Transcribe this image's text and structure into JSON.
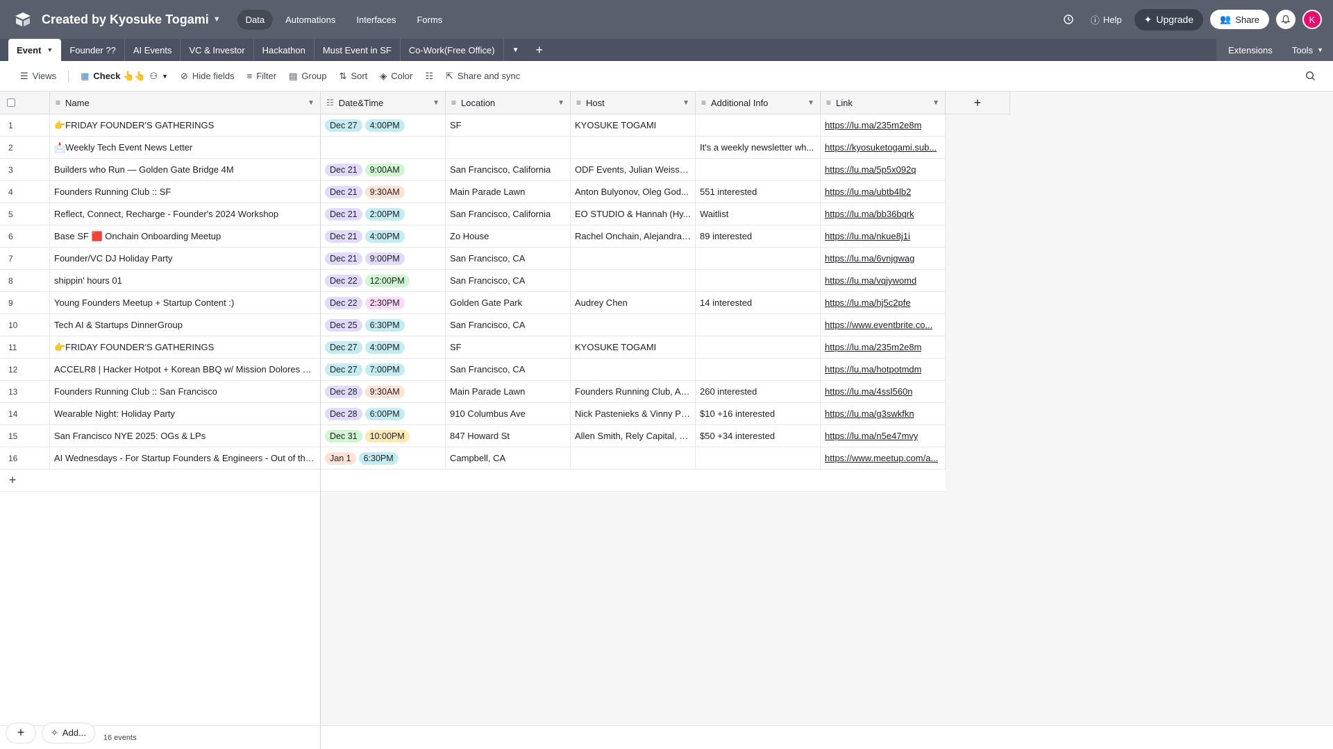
{
  "header": {
    "base_title": "Created by Kyosuke Togami",
    "nav": [
      "Data",
      "Automations",
      "Interfaces",
      "Forms"
    ],
    "help": "Help",
    "upgrade": "Upgrade",
    "share": "Share",
    "avatar_initial": "K"
  },
  "tabs": {
    "items": [
      "Event",
      "Founder ??",
      "AI Events",
      "VC & Investor",
      "Hackathon",
      "Must Event in SF",
      "Co-Work(Free Office)"
    ],
    "extensions": "Extensions",
    "tools": "Tools"
  },
  "toolbar": {
    "views": "Views",
    "view_name": "Check 👆👆",
    "hide_fields": "Hide fields",
    "filter": "Filter",
    "group": "Group",
    "sort": "Sort",
    "color": "Color",
    "share_sync": "Share and sync"
  },
  "columns": {
    "name": "Name",
    "date": "Date&Time",
    "location": "Location",
    "host": "Host",
    "info": "Additional Info",
    "link": "Link"
  },
  "colors": {
    "teal": "#c4ecf0",
    "purple": "#e2d9fb",
    "green": "#cff5d1",
    "orange": "#fee2d5",
    "pink": "#ffdaf6",
    "yellow": "#ffeab6"
  },
  "rows": [
    {
      "num": "1",
      "name": "👉FRIDAY FOUNDER'S GATHERINGS",
      "date": "Dec 27",
      "date_color": "teal",
      "time": "4:00PM",
      "time_color": "teal",
      "location": "SF",
      "host": "KYOSUKE TOGAMI",
      "info": "",
      "link": "https://lu.ma/235m2e8m"
    },
    {
      "num": "2",
      "name": "📩Weekly Tech Event News Letter",
      "date": "",
      "date_color": "",
      "time": "",
      "time_color": "",
      "location": "",
      "host": "",
      "info": "It's a weekly newsletter wh...",
      "link": "https://kyosuketogami.sub..."
    },
    {
      "num": "3",
      "name": "Builders who Run — Golden Gate Bridge 4M",
      "date": "Dec 21",
      "date_color": "purple",
      "time": "9:00AM",
      "time_color": "green",
      "location": "San Francisco, California",
      "host": "ODF Events, Julian Weisser, ...",
      "info": "",
      "link": "https://lu.ma/5p5x092q"
    },
    {
      "num": "4",
      "name": "Founders Running Club :: SF",
      "date": "Dec 21",
      "date_color": "purple",
      "time": "9:30AM",
      "time_color": "orange",
      "location": "Main Parade Lawn",
      "host": "Anton Bulyonov, Oleg God...",
      "info": "551 interested",
      "link": "https://lu.ma/ubtb4lb2"
    },
    {
      "num": "5",
      "name": "Reflect, Connect, Recharge - Founder's 2024 Workshop",
      "date": "Dec 21",
      "date_color": "purple",
      "time": "2:00PM",
      "time_color": "teal",
      "location": "San Francisco, California",
      "host": "EO STUDIO & Hannah (Hy...",
      "info": "Waitlist",
      "link": "https://lu.ma/bb36bqrk"
    },
    {
      "num": "6",
      "name": "Base SF 🟥 Onchain Onboarding Meetup",
      "date": "Dec 21",
      "date_color": "purple",
      "time": "4:00PM",
      "time_color": "teal",
      "location": "Zo House",
      "host": "Rachel Onchain, Alejandra ...",
      "info": "89 interested",
      "link": "https://lu.ma/nkue8j1i"
    },
    {
      "num": "7",
      "name": "Founder/VC DJ Holiday Party",
      "date": "Dec 21",
      "date_color": "purple",
      "time": "9:00PM",
      "time_color": "purple",
      "location": "San Francisco, CA",
      "host": "",
      "info": "",
      "link": "https://lu.ma/6vnjgwag"
    },
    {
      "num": "8",
      "name": "shippin' hours 01",
      "date": "Dec 22",
      "date_color": "purple",
      "time": "12:00PM",
      "time_color": "green",
      "location": "San Francisco, CA",
      "host": "",
      "info": "",
      "link": "https://lu.ma/vqjywomd"
    },
    {
      "num": "9",
      "name": "Young Founders Meetup + Startup Content :)",
      "date": "Dec 22",
      "date_color": "purple",
      "time": "2:30PM",
      "time_color": "pink",
      "location": "Golden Gate Park",
      "host": "Audrey Chen",
      "info": "14 interested",
      "link": "https://lu.ma/hj5c2pfe"
    },
    {
      "num": "10",
      "name": "Tech AI & Startups DinnerGroup",
      "date": "Dec 25",
      "date_color": "purple",
      "time": "6:30PM",
      "time_color": "teal",
      "location": "San Francisco, CA",
      "host": "",
      "info": "",
      "link": "https://www.eventbrite.co..."
    },
    {
      "num": "11",
      "name": "👉FRIDAY FOUNDER'S GATHERINGS",
      "date": "Dec 27",
      "date_color": "teal",
      "time": "4:00PM",
      "time_color": "teal",
      "location": "SF",
      "host": "KYOSUKE TOGAMI",
      "info": "",
      "link": "https://lu.ma/235m2e8m"
    },
    {
      "num": "12",
      "name": "ACCELR8 | Hacker Hotpot + Korean BBQ w/ Mission Dolores Ma...",
      "date": "Dec 27",
      "date_color": "teal",
      "time": "7:00PM",
      "time_color": "teal",
      "location": "San Francisco, CA",
      "host": "",
      "info": "",
      "link": "https://lu.ma/hotpotmdm"
    },
    {
      "num": "13",
      "name": "Founders Running Club :: San Francisco",
      "date": "Dec 28",
      "date_color": "purple",
      "time": "9:30AM",
      "time_color": "orange",
      "location": "Main Parade Lawn",
      "host": "Founders Running Club, An...",
      "info": "260 interested",
      "link": "https://lu.ma/4ssl560n"
    },
    {
      "num": "14",
      "name": "Wearable Night: Holiday Party",
      "date": "Dec 28",
      "date_color": "purple",
      "time": "6:00PM",
      "time_color": "teal",
      "location": "910 Columbus Ave",
      "host": "Nick Pastenieks & Vinny Ph...",
      "info": "$10 +16 interested",
      "link": "https://lu.ma/g3swkfkn"
    },
    {
      "num": "15",
      "name": "San Francisco NYE 2025: OGs & LPs",
      "date": "Dec 31",
      "date_color": "green",
      "time": "10:00PM",
      "time_color": "yellow",
      "location": "847 Howard St",
      "host": "Allen Smith, Rely Capital, Fr...",
      "info": "$50 +34 interested",
      "link": "https://lu.ma/n5e47mvy"
    },
    {
      "num": "16",
      "name": "AI Wednesdays - For Startup Founders & Engineers - Out of the ...",
      "date": "Jan 1",
      "date_color": "orange",
      "time": "6:30PM",
      "time_color": "teal",
      "location": "Campbell, CA",
      "host": "",
      "info": "",
      "link": "https://www.meetup.com/a..."
    }
  ],
  "footer": {
    "add_label": "Add...",
    "count": "16 events"
  }
}
